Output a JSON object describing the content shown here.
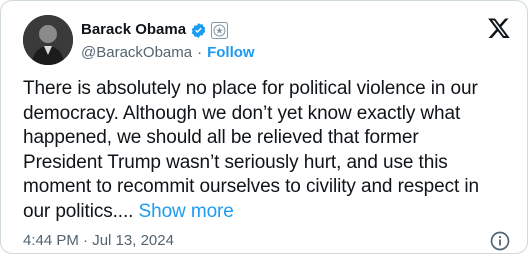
{
  "user": {
    "display_name": "Barack Obama",
    "handle": "@BarackObama",
    "separator": "·",
    "follow_label": "Follow"
  },
  "tweet": {
    "lines": [
      "There is absolutely no place for political violence in our",
      "democracy. Although we don’t yet know exactly what",
      "happened, we should all be relieved that former",
      "President Trump wasn’t seriously hurt, and use this",
      "moment to recommit ourselves to civility and respect in",
      "our politics...."
    ],
    "show_more_label": "Show more",
    "time": "4:44 PM",
    "date": "Jul 13, 2024",
    "meta_separator": "·"
  },
  "icons": {
    "verified": "verified-badge-icon",
    "government": "us-government-seal-icon",
    "platform": "x-logo-icon",
    "info": "info-icon"
  },
  "colors": {
    "accent": "#1d9bf0",
    "text": "#0f1419",
    "muted": "#536471",
    "border": "#cfd9de"
  }
}
